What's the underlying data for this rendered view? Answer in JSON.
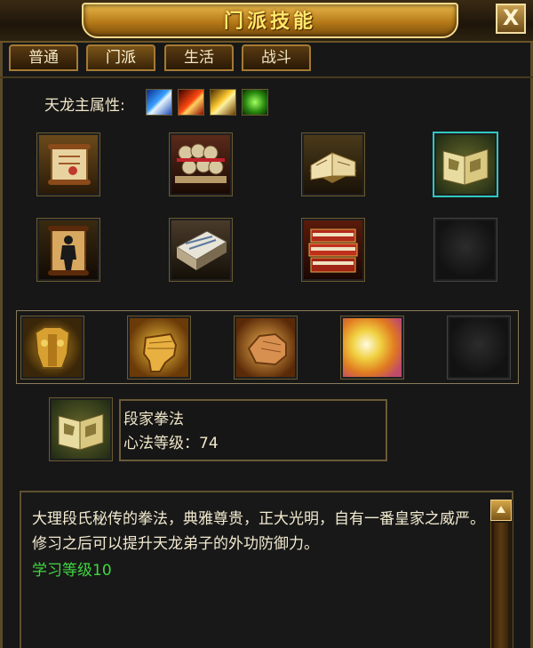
{
  "window": {
    "title": "门派技能",
    "close_label": "X"
  },
  "tabs": [
    {
      "label": "普通",
      "active": false
    },
    {
      "label": "门派",
      "active": true
    },
    {
      "label": "生活",
      "active": false
    },
    {
      "label": "战斗",
      "active": false
    }
  ],
  "attributes": {
    "label": "天龙主属性:",
    "icons": [
      "ice-attribute-icon",
      "fire-attribute-icon",
      "lightning-attribute-icon",
      "poison-attribute-icon"
    ]
  },
  "skill_book_grid": [
    [
      "scroll-icon",
      "bundled-scrolls-icon",
      "open-book-icon",
      "open-book-glowing-icon"
    ],
    [
      "figure-scroll-icon",
      "stitched-manual-icon",
      "red-books-stack-icon",
      "empty-slot"
    ]
  ],
  "skill_row": [
    "golden-armor-icon",
    "fist-icon",
    "palm-icon",
    "light-burst-icon",
    "empty-slot"
  ],
  "selected_skill": {
    "icon": "open-book-glowing-icon",
    "name": "段家拳法",
    "level_text": "心法等级：74"
  },
  "description": {
    "text": "大理段氏秘传的拳法，典雅尊贵，正大光明，自有一番皇家之威严。修习之后可以提升天龙弟子的外功防御力。",
    "learn_level": "学习等级10"
  },
  "colors": {
    "title_gold": "#ffe86a",
    "text": "#f0e6c8",
    "learn_green": "#3fd63f",
    "selection_cyan": "#2ec9c0"
  }
}
